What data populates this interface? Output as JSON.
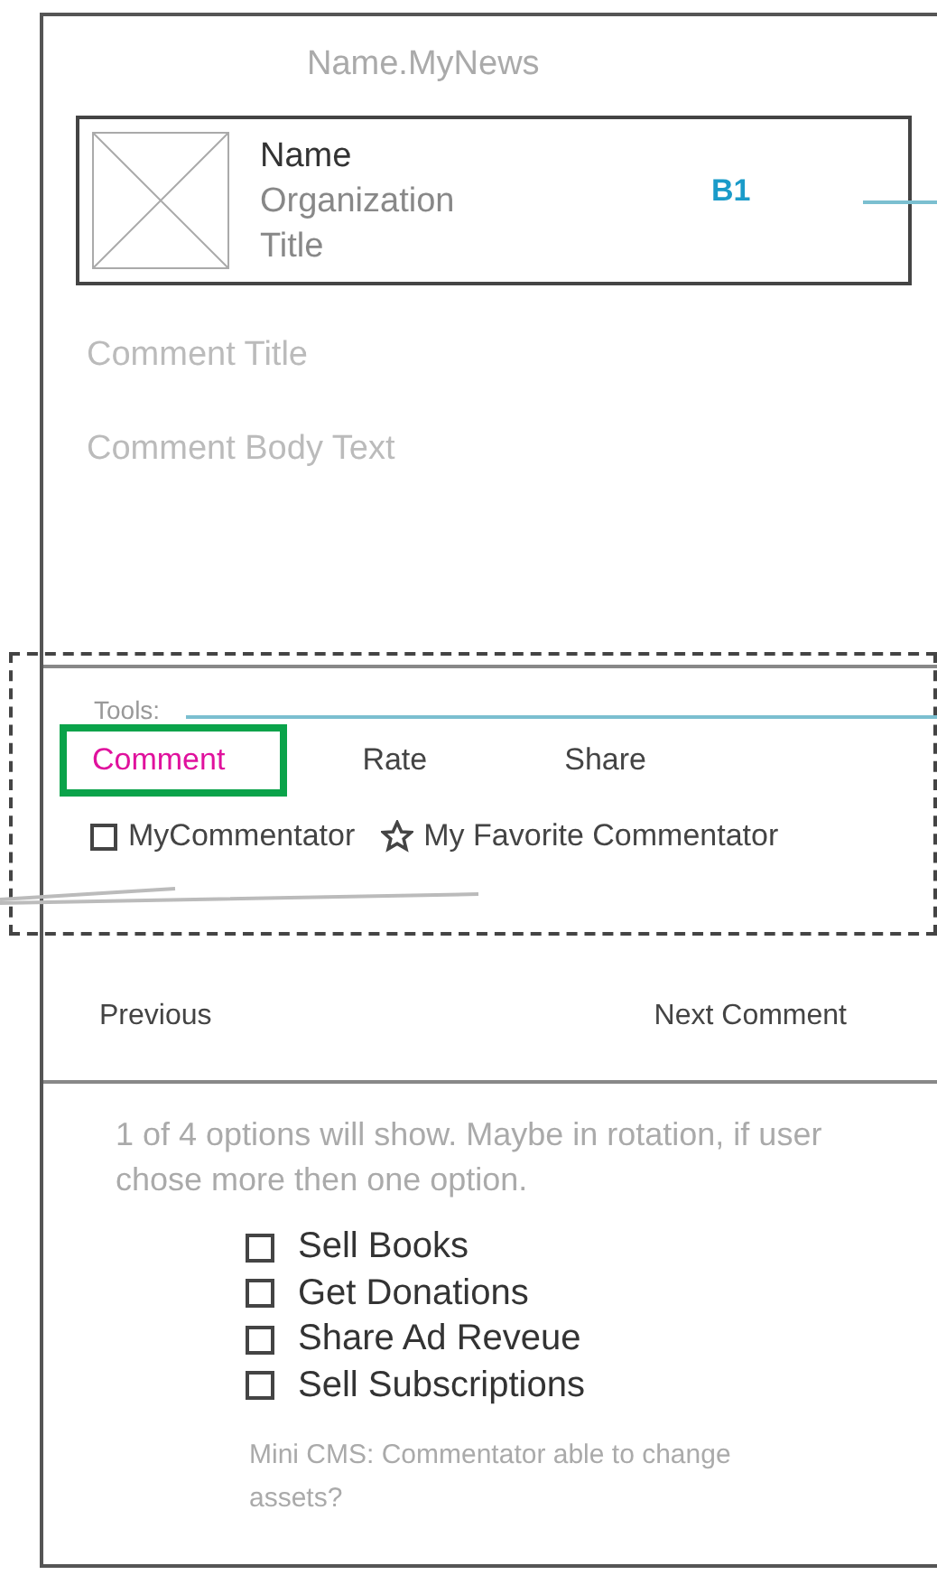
{
  "site_title": "Name.MyNews",
  "profile": {
    "name": "Name",
    "organization": "Organization",
    "title": "Title",
    "marker": "B1"
  },
  "comment": {
    "title": "Comment Title",
    "body": "Comment Body Text"
  },
  "tools": {
    "label": "Tools:",
    "tabs": [
      {
        "label": "Comment",
        "selected": true
      },
      {
        "label": "Rate",
        "selected": false
      },
      {
        "label": "Share",
        "selected": false
      }
    ],
    "follow": [
      {
        "kind": "checkbox",
        "label": "MyCommentator",
        "checked": false
      },
      {
        "kind": "star",
        "label": "My Favorite Commentator",
        "checked": false
      }
    ]
  },
  "navigation": {
    "previous": "Previous",
    "next": "Next Comment"
  },
  "note": "1 of 4 options will show. Maybe in rotation, if user chose more then one option.",
  "options": [
    {
      "label": "Sell Books",
      "checked": false
    },
    {
      "label": "Get Donations",
      "checked": false
    },
    {
      "label": "Share Ad Reveue",
      "checked": false
    },
    {
      "label": "Sell Subscriptions",
      "checked": false
    }
  ],
  "cms_note": "Mini CMS: Commentator able to change assets?"
}
